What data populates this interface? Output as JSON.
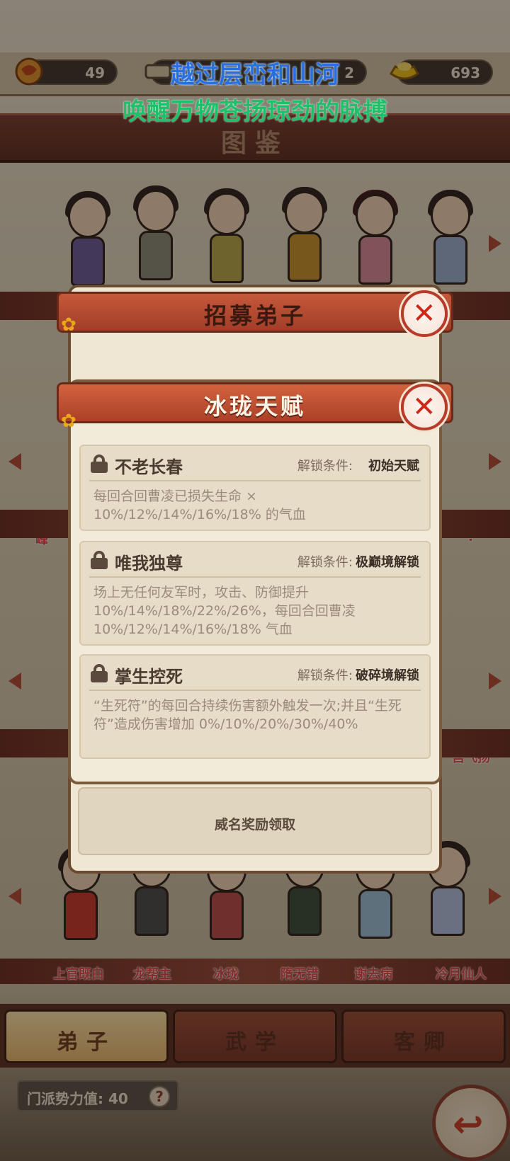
{
  "overlay": {
    "line1": "越过层峦和山河",
    "line2": "唤醒万物苍扬琼劲的脉搏"
  },
  "resources": [
    {
      "icon": "dragon-coin-icon",
      "value": "49"
    },
    {
      "icon": "scroll-icon",
      "value": "2"
    },
    {
      "icon": "gold-ingot-icon",
      "value": "693"
    }
  ],
  "page_title": "图鉴",
  "character_names": {
    "left_partial": "峰",
    "right_partial": "?",
    "left_partial_2": "",
    "right_partial_2": "宫飞扬",
    "bottom_row": [
      "上官既白",
      "龙帮主",
      "冰珑",
      "隋无错",
      "谢去病",
      "冷月仙人"
    ]
  },
  "recruit_dialog": {
    "title": "招募弟子",
    "bottom_text": "威名奖励领取"
  },
  "talent_dialog": {
    "title": "冰珑天赋",
    "talents": [
      {
        "name": "不老长春",
        "cond_label": "解锁条件:",
        "cond_value": "初始天赋",
        "desc": "每回合回曹凌已损失生命 × 10%/12%/14%/16%/18% 的气血"
      },
      {
        "name": "唯我独尊",
        "cond_label": "解锁条件:",
        "cond_value": "极巅境解锁",
        "desc": "场上无任何友军时，攻击、防御提升 10%/14%/18%/22%/26%，每回合回曹凌 10%/12%/14%/16%/18% 气血"
      },
      {
        "name": "掌生控死",
        "cond_label": "解锁条件:",
        "cond_value": "破碎境解锁",
        "desc": "“生死符”的每回合持续伤害额外触发一次;并且“生死符”造成伤害增加 0%/10%/20%/30%/40%"
      }
    ]
  },
  "tabs": [
    {
      "label": "弟子",
      "active": true
    },
    {
      "label": "武学",
      "active": false
    },
    {
      "label": "客卿",
      "active": false
    }
  ],
  "power": {
    "label": "门派势力值: 40"
  },
  "colors": {
    "accent": "#c83a22",
    "panel": "#f3ebda",
    "brand_red": "#a13e28"
  }
}
